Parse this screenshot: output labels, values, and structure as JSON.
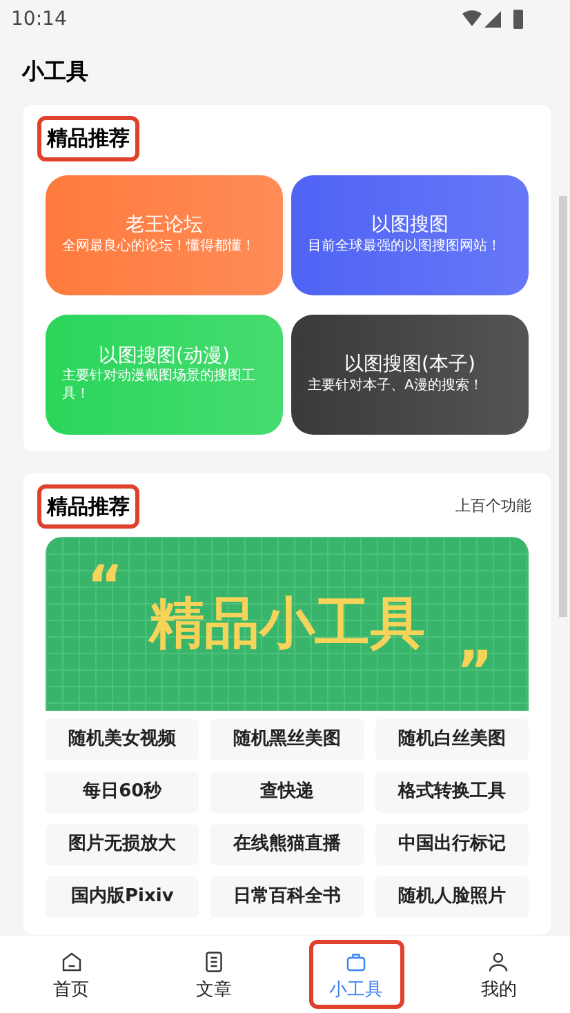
{
  "status_bar": {
    "time": "10:14"
  },
  "page_title": "小工具",
  "featured": {
    "title": "精品推荐",
    "annotated": true,
    "tiles": [
      {
        "title": "老王论坛",
        "desc": "全网最良心的论坛！懂得都懂！",
        "color": "#ff7a3d"
      },
      {
        "title": "以图搜图",
        "desc": "目前全球最强的以图搜图网站！",
        "color": "#4f63f5"
      },
      {
        "title": "以图搜图(动漫)",
        "desc": "主要针对动漫截图场景的搜图工具！",
        "color": "#2ad65a"
      },
      {
        "title": "以图搜图(本子)",
        "desc": "主要针对本子、A漫的搜索！",
        "color": "#3a3a3a"
      }
    ]
  },
  "tools": {
    "title": "精品推荐",
    "annotated": true,
    "more": "上百个功能",
    "banner": {
      "quote_open": "“",
      "text": "精品小工具",
      "quote_close": "”"
    },
    "items": [
      "随机美女视频",
      "随机黑丝美图",
      "随机白丝美图",
      "每日60秒",
      "查快递",
      "格式转换工具",
      "图片无损放大",
      "在线熊猫直播",
      "中国出行标记",
      "国内版Pixiv",
      "日常百科全书",
      "随机人脸照片"
    ]
  },
  "nav": [
    {
      "label": "首页",
      "kind": "home",
      "selected": false,
      "annotated": false
    },
    {
      "label": "文章",
      "kind": "doc",
      "selected": false,
      "annotated": false
    },
    {
      "label": "小工具",
      "kind": "tool",
      "selected": true,
      "annotated": true
    },
    {
      "label": "我的",
      "kind": "user",
      "selected": false,
      "annotated": false
    }
  ]
}
